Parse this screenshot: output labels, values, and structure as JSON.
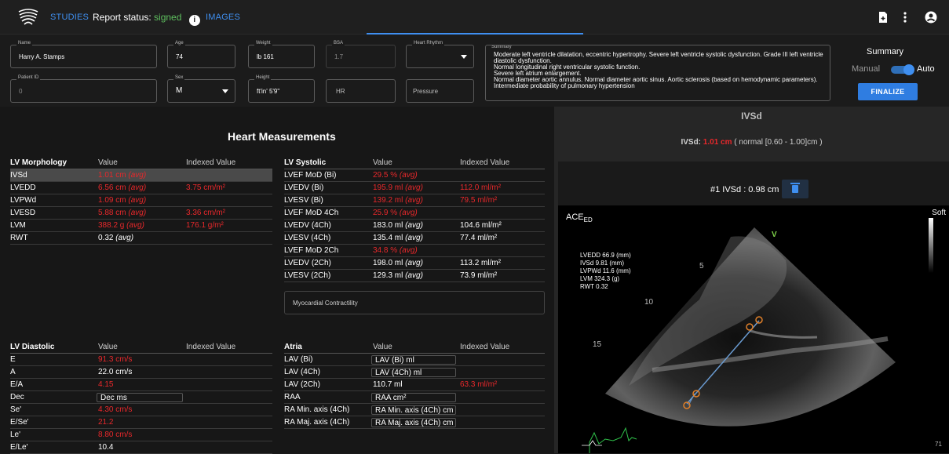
{
  "nav": {
    "studies": "STUDIES",
    "report_status_label": "Report status:",
    "report_status_value": "signed",
    "images": "IMAGES"
  },
  "patient": {
    "name_label": "Name",
    "name": "Harry A. Stamps",
    "age_label": "Age",
    "age": "74",
    "weight_label": "Weight",
    "weight": "lb  161",
    "bsa_label": "BSA",
    "bsa": "1.7",
    "rhythm_label": "Heart Rhythm",
    "patient_id_label": "Patient ID",
    "patient_id": "0",
    "sex_label": "Sex",
    "sex": "M",
    "height_label": "Height",
    "height": "ft'in'  5'9\"",
    "hr_placeholder": "HR",
    "pressure_placeholder": "Pressure",
    "summary_label": "Summary",
    "summary_text": "Moderate left ventricle dilatation, eccentric hypertrophy. Severe left ventricle systolic dysfunction. Grade III left ventricle diastolic dysfunction.\nNormal longitudinal right ventricular systolic function.\nSevere left atrium enlargement.\nNormal diameter aortic annulus. Normal diameter aortic sinus. Aortic sclerosis (based on hemodynamic parameters).\nIntermediate probability of pulmonary hypertension"
  },
  "summary_ctrl": {
    "title": "Summary",
    "manual": "Manual",
    "auto": "Auto",
    "finalize": "FINALIZE"
  },
  "main": {
    "title": "Heart Measurements",
    "myo": "Myocardial Contractility"
  },
  "lv_morph": {
    "headers": [
      "LV Morphology",
      "Value",
      "Indexed Value"
    ],
    "rows": [
      {
        "n": "IVSd",
        "v": "1.01 cm",
        "t": "(avg)",
        "i": "",
        "red": true
      },
      {
        "n": "LVEDD",
        "v": "6.56 cm",
        "t": "(avg)",
        "i": "3.75 cm/m²",
        "red": true
      },
      {
        "n": "LVPWd",
        "v": "1.09 cm",
        "t": "(avg)",
        "i": "",
        "red": true
      },
      {
        "n": "LVESD",
        "v": "5.88 cm",
        "t": "(avg)",
        "i": "3.36 cm/m²",
        "red": true
      },
      {
        "n": "LVM",
        "v": "388.2 g",
        "t": "(avg)",
        "i": "176.1 g/m²",
        "red": true
      },
      {
        "n": "RWT",
        "v": "0.32",
        "t": "(avg)",
        "i": "",
        "red": false
      }
    ]
  },
  "lv_sys": {
    "headers": [
      "LV Systolic",
      "Value",
      "Indexed Value"
    ],
    "rows": [
      {
        "n": "LVEF MoD (Bi)",
        "v": "29.5 %",
        "t": "(avg)",
        "i": "",
        "red": true,
        "ired": false
      },
      {
        "n": "LVEDV (Bi)",
        "v": "195.9 ml",
        "t": "(avg)",
        "i": "112.0 ml/m²",
        "red": true,
        "ired": true
      },
      {
        "n": "LVESV (Bi)",
        "v": "139.2 ml",
        "t": "(avg)",
        "i": "79.5 ml/m²",
        "red": true,
        "ired": true
      },
      {
        "n": "LVEF MoD 4Ch",
        "v": "25.9 %",
        "t": "(avg)",
        "i": "",
        "red": true,
        "ired": false
      },
      {
        "n": "LVEDV (4Ch)",
        "v": "183.0 ml",
        "t": "(avg)",
        "i": "104.6 ml/m²",
        "red": false,
        "ired": false
      },
      {
        "n": "LVESV (4Ch)",
        "v": "135.4 ml",
        "t": "(avg)",
        "i": "77.4 ml/m²",
        "red": false,
        "ired": false
      },
      {
        "n": "LVEF MoD 2Ch",
        "v": "34.8 %",
        "t": "(avg)",
        "i": "",
        "red": true,
        "ired": false
      },
      {
        "n": "LVEDV (2Ch)",
        "v": "198.0 ml",
        "t": "(avg)",
        "i": "113.2 ml/m²",
        "red": false,
        "ired": false
      },
      {
        "n": "LVESV (2Ch)",
        "v": "129.3 ml",
        "t": "(avg)",
        "i": "73.9 ml/m²",
        "red": false,
        "ired": false
      }
    ]
  },
  "lv_dia": {
    "headers": [
      "LV Diastolic",
      "Value",
      "Indexed Value"
    ],
    "rows": [
      {
        "n": "E",
        "v": "91.3 cm/s",
        "red": true
      },
      {
        "n": "A",
        "v": "22.0 cm/s",
        "red": false
      },
      {
        "n": "E/A",
        "v": "4.15",
        "red": true
      },
      {
        "n": "Dec",
        "v": "",
        "ph": "Dec ms",
        "red": false
      },
      {
        "n": "Se'",
        "v": "4.30 cm/s",
        "red": true
      },
      {
        "n": "E/Se'",
        "v": "21.2",
        "red": true
      },
      {
        "n": "Le'",
        "v": "8.80 cm/s",
        "red": true
      },
      {
        "n": "E/Le'",
        "v": "10.4",
        "red": false
      }
    ]
  },
  "atria": {
    "headers": [
      "Atria",
      "Value",
      "Indexed Value"
    ],
    "rows": [
      {
        "n": "LAV (Bi)",
        "v": "",
        "ph": "LAV (Bi) ml",
        "i": ""
      },
      {
        "n": "LAV (4Ch)",
        "v": "",
        "ph": "LAV (4Ch) ml",
        "i": ""
      },
      {
        "n": "LAV (2Ch)",
        "v": "110.7 ml",
        "ph": "",
        "i": "63.3 ml/m²"
      },
      {
        "n": "RAA",
        "v": "",
        "ph": "RAA cm²",
        "i": ""
      },
      {
        "n": "RA Min. axis (4Ch)",
        "v": "",
        "ph": "RA Min. axis (4Ch) cm",
        "i": ""
      },
      {
        "n": "RA Maj. axis (4Ch)",
        "v": "",
        "ph": "RA Maj. axis (4Ch) cm",
        "i": ""
      }
    ]
  },
  "viewer": {
    "title": "IVSd",
    "sub_label": "IVSd:",
    "sub_value": "1.01 cm",
    "sub_range": "( normal [0.60 - 1.00]cm )",
    "measurement": "#1 IVSd : 0.98 cm",
    "ace": "ACE",
    "ace_sub": "ED",
    "soft": "Soft",
    "overlay": [
      "LVEDD 66.9 (mm)",
      "IVSd 9.81 (mm)",
      "LVPWd 11.6 (mm)",
      "LVM 324.3 (g)",
      "RWT 0.32"
    ],
    "depth_5": "5",
    "depth_10": "10",
    "depth_15": "15",
    "v_marker": "V",
    "corner": "71"
  },
  "colors": {
    "accent": "#3f8ff0",
    "abnormal": "#e8282b",
    "signed": "#5fc05f"
  }
}
